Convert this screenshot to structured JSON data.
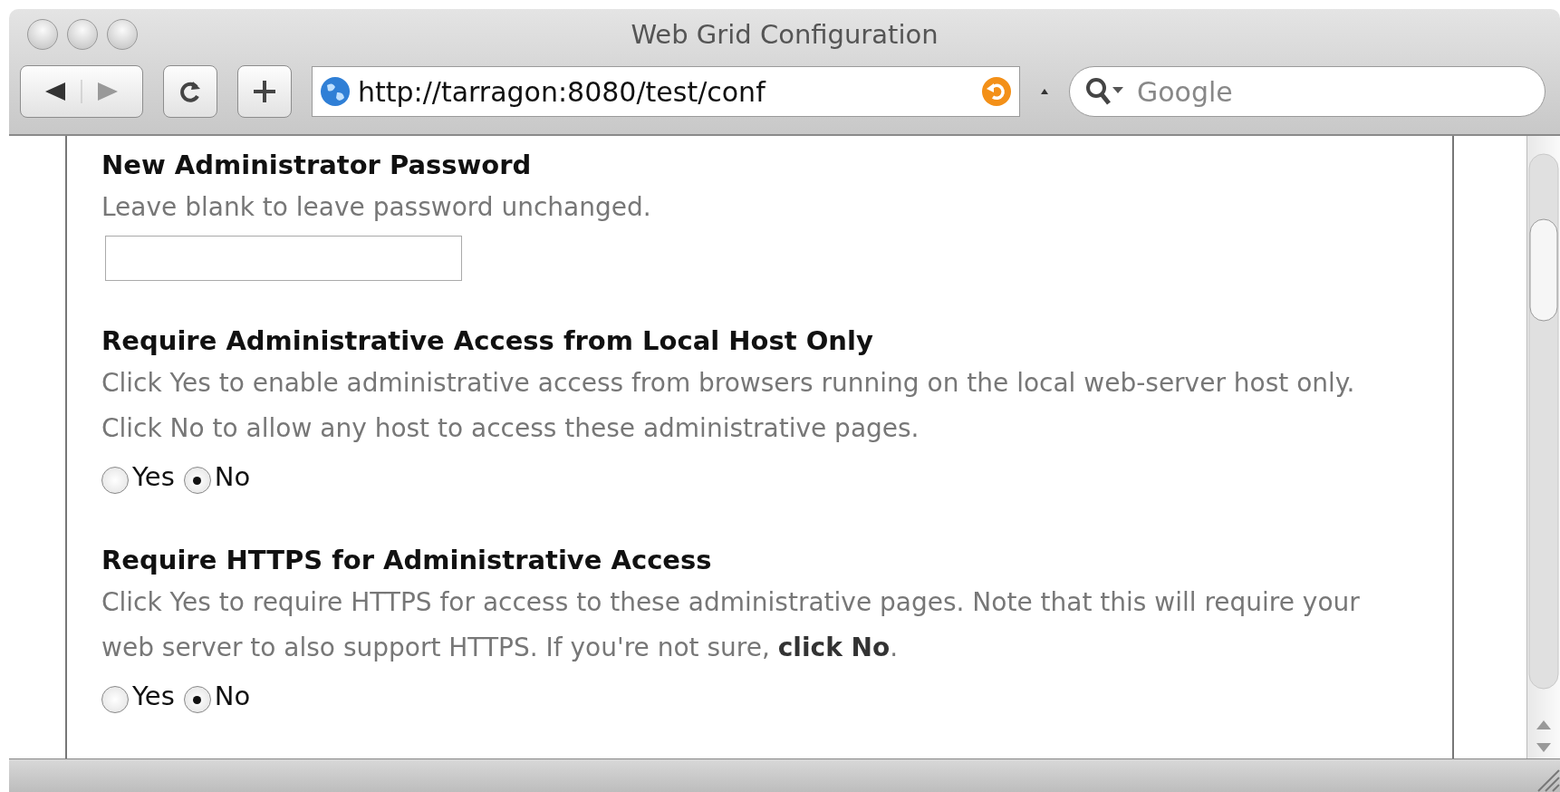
{
  "window": {
    "title": "Web Grid Configuration"
  },
  "toolbar": {
    "url": "http://tarragon:8080/test/conf",
    "search": {
      "placeholder": "Google"
    }
  },
  "sections": [
    {
      "kind": "password",
      "heading": "New Administrator Password",
      "description": "Leave blank to leave password unchanged."
    },
    {
      "kind": "radio",
      "heading": "Require Administrative Access from Local Host Only",
      "description": "Click Yes to enable administrative access from browsers running on the local web-server host only. Click No to allow any host to access these administrative pages.",
      "options": [
        {
          "label": "Yes",
          "selected": false
        },
        {
          "label": "No",
          "selected": true
        }
      ]
    },
    {
      "kind": "radio",
      "heading": "Require HTTPS for Administrative Access",
      "description": "Click Yes to require HTTPS for access to these administrative pages. Note that this will require your web server to also support HTTPS. If you're not sure, **click No**.",
      "options": [
        {
          "label": "Yes",
          "selected": false
        },
        {
          "label": "No",
          "selected": true
        }
      ]
    }
  ]
}
